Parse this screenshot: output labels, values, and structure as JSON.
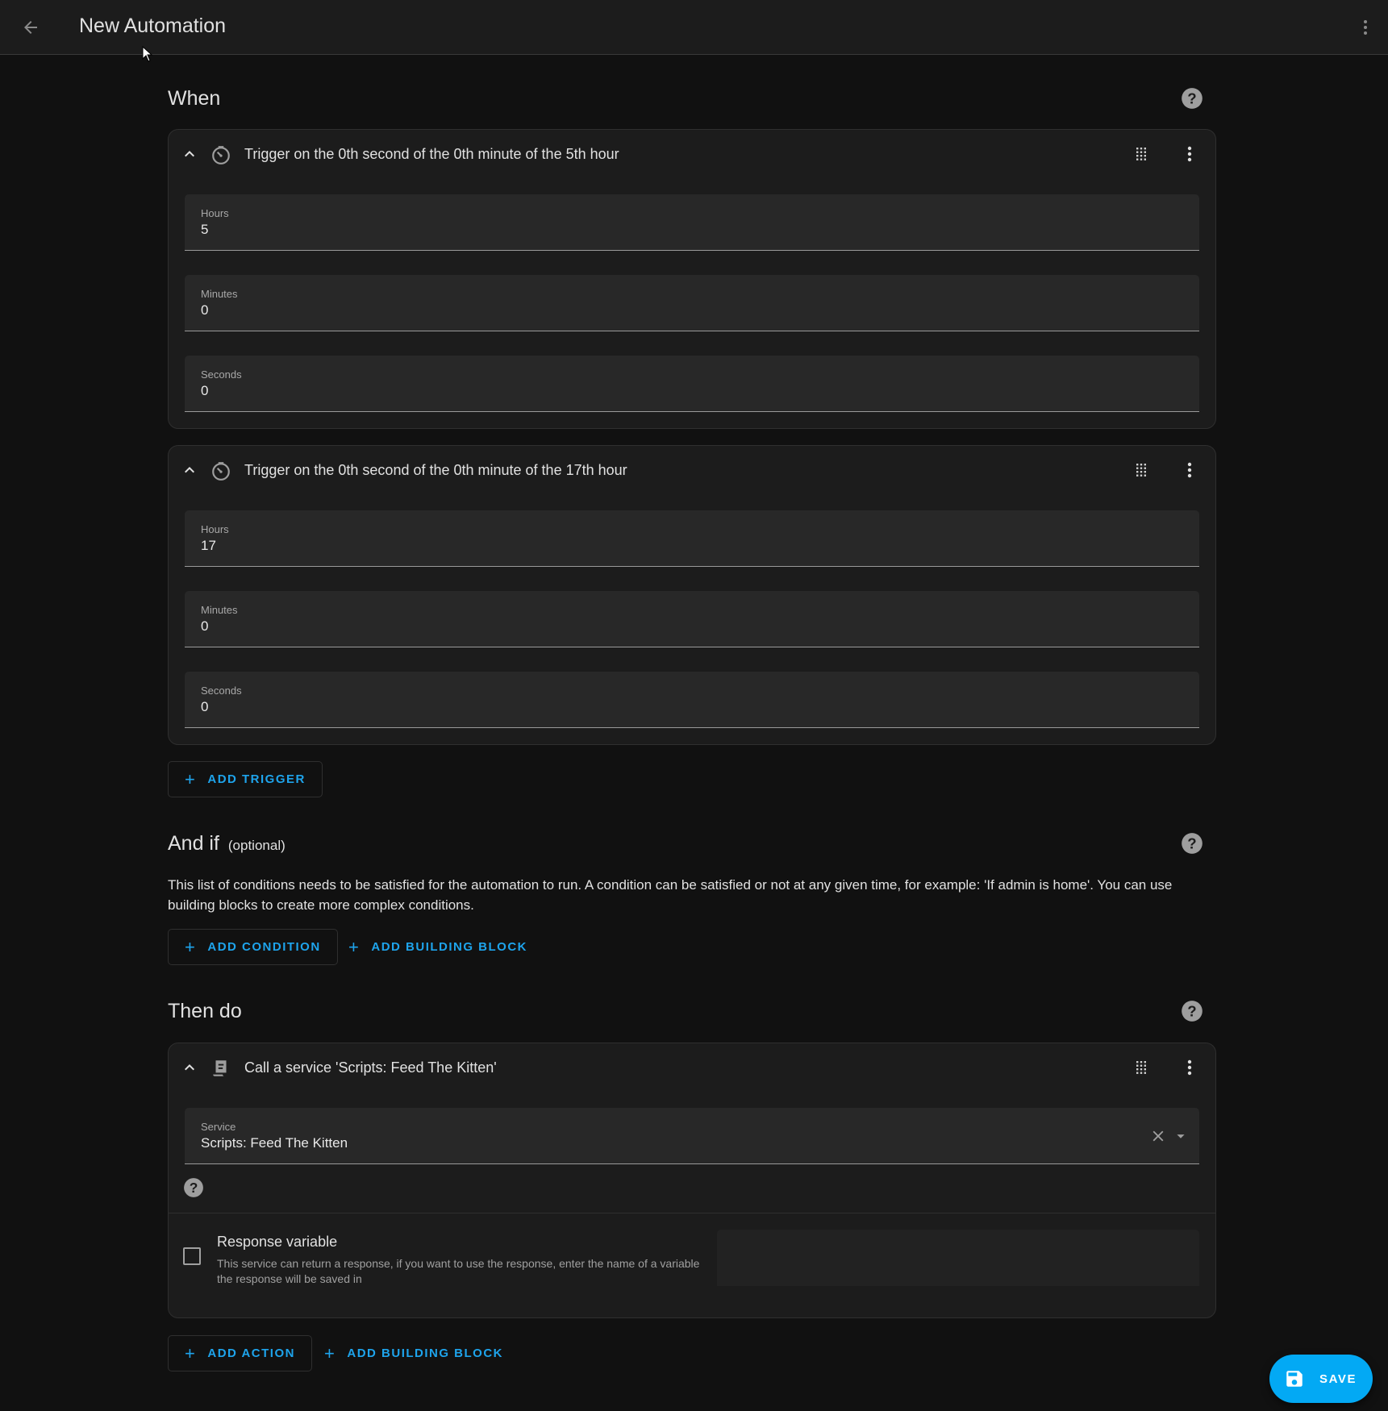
{
  "topbar": {
    "title": "New Automation",
    "back_icon": "arrow-left-icon",
    "menu_icon": "dots-vertical-icon"
  },
  "when": {
    "title": "When",
    "help_icon": "help-circle-icon",
    "triggers": [
      {
        "title": "Trigger on the 0th second of the 0th minute of the 5th hour",
        "icon": "timer-clock-icon",
        "fields": [
          {
            "label": "Hours",
            "value": "5"
          },
          {
            "label": "Minutes",
            "value": "0"
          },
          {
            "label": "Seconds",
            "value": "0"
          }
        ]
      },
      {
        "title": "Trigger on the 0th second of the 0th minute of the 17th hour",
        "icon": "timer-clock-icon",
        "fields": [
          {
            "label": "Hours",
            "value": "17"
          },
          {
            "label": "Minutes",
            "value": "0"
          },
          {
            "label": "Seconds",
            "value": "0"
          }
        ]
      }
    ],
    "add_trigger_label": "ADD TRIGGER"
  },
  "and_if": {
    "title": "And if",
    "optional_label": "(optional)",
    "description": "This list of conditions needs to be satisfied for the automation to run. A condition can be satisfied or not at any given time, for example: 'If admin is home'. You can use building blocks to create more complex conditions.",
    "add_condition_label": "ADD CONDITION",
    "add_building_block_label": "ADD BUILDING BLOCK"
  },
  "then_do": {
    "title": "Then do",
    "actions": [
      {
        "title": "Call a service 'Scripts: Feed The Kitten'",
        "icon": "script-icon",
        "service_label": "Service",
        "service_value": "Scripts: Feed The Kitten",
        "response_variable": {
          "label": "Response variable",
          "description": "This service can return a response, if you want to use the response, enter the name of a variable the response will be saved in",
          "checked": false,
          "value": ""
        }
      }
    ],
    "add_action_label": "ADD ACTION",
    "add_building_block_label": "ADD BUILDING BLOCK"
  },
  "save_button": {
    "label": "SAVE",
    "icon": "content-save-icon"
  },
  "colors": {
    "accent": "#03a9f4",
    "link": "#1ea4ec",
    "background": "#111111",
    "card": "#1c1c1c"
  }
}
